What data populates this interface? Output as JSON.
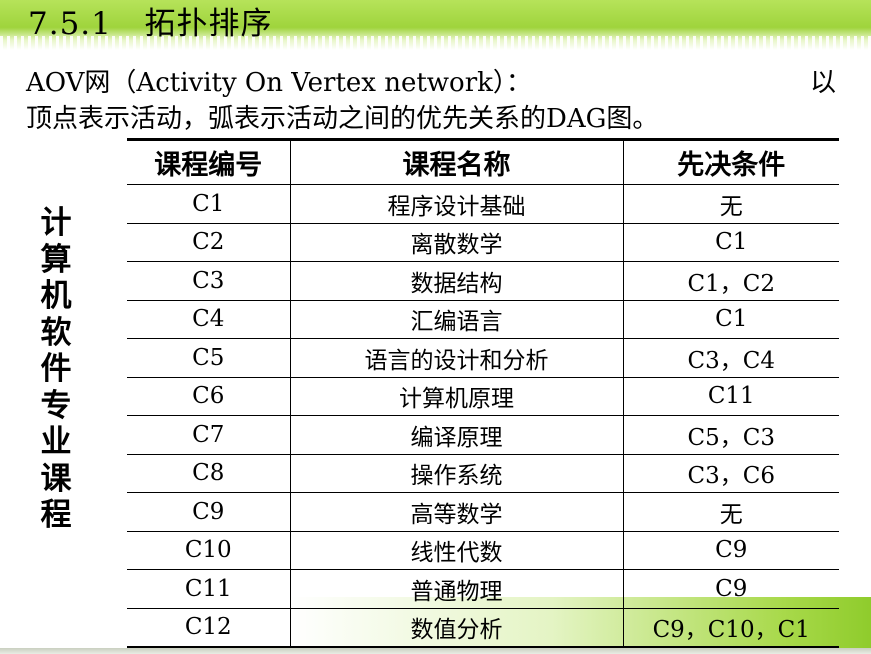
{
  "slide": {
    "title": "7.5.1   拓扑排序",
    "intro_line1_left": "AOV网（Activity  On Vertex network）：",
    "intro_line1_right": "以",
    "intro_line2": "顶点表示活动，弧表示活动之间的优先关系的DAG图。",
    "side_label": "计算机软件专业课程"
  },
  "table": {
    "headers": [
      "课程编号",
      "课程名称",
      "先决条件"
    ],
    "rows": [
      [
        "C1",
        "程序设计基础",
        "无"
      ],
      [
        "C2",
        "离散数学",
        "C1"
      ],
      [
        "C3",
        "数据结构",
        "C1，C2"
      ],
      [
        "C4",
        "汇编语言",
        "C1"
      ],
      [
        "C5",
        "语言的设计和分析",
        "C3，C4"
      ],
      [
        "C6",
        "计算机原理",
        "C11"
      ],
      [
        "C7",
        "编译原理",
        "C5，C3"
      ],
      [
        "C8",
        "操作系统",
        "C3，C6"
      ],
      [
        "C9",
        "高等数学",
        "无"
      ],
      [
        "C10",
        "线性代数",
        "C9"
      ],
      [
        "C11",
        "普通物理",
        "C9"
      ],
      [
        "C12",
        "数值分析",
        "C9，C10，C1"
      ]
    ]
  },
  "colors": {
    "accent_green": "#9fd43c",
    "text": "#000000"
  }
}
